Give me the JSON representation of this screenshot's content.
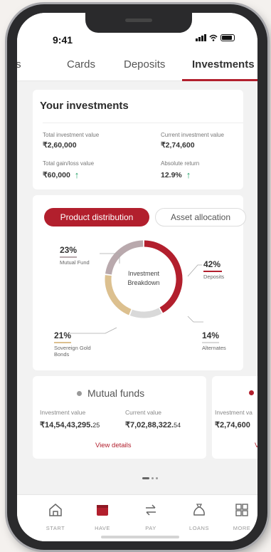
{
  "status": {
    "time": "9:41"
  },
  "tabs": {
    "partial": "ts",
    "cards": "Cards",
    "deposits": "Deposits",
    "investments": "Investments"
  },
  "investments": {
    "title": "Your investments",
    "total_investment": {
      "label": "Total investment value",
      "value": "₹2,60,000"
    },
    "current_investment": {
      "label": "Current investment value",
      "value": "₹2,74,600"
    },
    "gain_loss": {
      "label": "Total gain/loss value",
      "value": "₹60,000",
      "trend": "up"
    },
    "absolute_return": {
      "label": "Absolute return",
      "value": "12.9%",
      "trend": "up"
    }
  },
  "distribution": {
    "toggle_active": "Product distribution",
    "toggle_inactive": "Asset allocation",
    "center_label_line1": "Investment",
    "center_label_line2": "Breakdown",
    "segments": [
      {
        "percent": "23%",
        "label": "Mutual Fund",
        "value": 23,
        "color": "#b9a9ad"
      },
      {
        "percent": "42%",
        "label": "Deposits",
        "value": 42,
        "color": "#b21f2d"
      },
      {
        "percent": "14%",
        "label": "Alternates",
        "value": 14,
        "color": "#d9d9d9"
      },
      {
        "percent": "21%",
        "label_line1": "Sovereign Gold",
        "label_line2": "Bonds",
        "value": 21,
        "color": "#dcc08f"
      }
    ]
  },
  "product_cards": [
    {
      "title": "Mutual funds",
      "dot_color": "#999999",
      "investment_label": "Investment value",
      "investment_main": "₹14,54,43,295.",
      "investment_decimals": "25",
      "current_label": "Current value",
      "current_main": "₹7,02,88,322.",
      "current_decimals": "54",
      "view_details": "View details"
    },
    {
      "dot_color": "#b21f2d",
      "investment_label": "Investment va",
      "investment_main": "₹2,74,600",
      "view_details": "Vi"
    }
  ],
  "bottom_nav": {
    "start": "START",
    "have": "HAVE",
    "pay": "PAY",
    "loans": "LOANS",
    "more": "MORE"
  },
  "colors": {
    "accent": "#b21f2d",
    "positive": "#1e9e64"
  }
}
